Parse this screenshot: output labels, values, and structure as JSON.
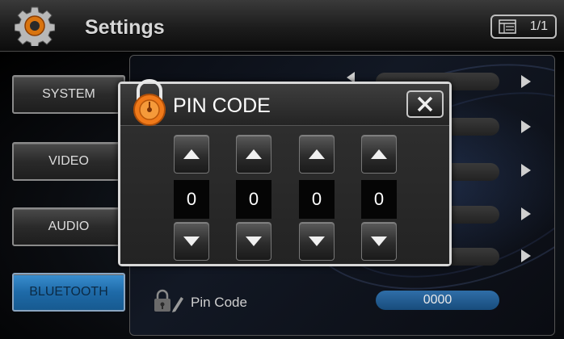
{
  "header": {
    "title": "Settings",
    "page_indicator": "1/1",
    "icons": [
      "gear-icon",
      "list-icon"
    ]
  },
  "sidebar": {
    "items": [
      {
        "label": "SYSTEM",
        "active": false
      },
      {
        "label": "VIDEO",
        "active": false
      },
      {
        "label": "AUDIO",
        "active": false
      },
      {
        "label": "BLUETOOTH",
        "active": true
      }
    ]
  },
  "settings_panel": {
    "pin_row": {
      "label": "Pin Code",
      "value": "0000",
      "icon": "lock-edit-icon"
    }
  },
  "pin_dialog": {
    "title": "PIN CODE",
    "close_icon": "close-icon",
    "digits": [
      "0",
      "0",
      "0",
      "0"
    ]
  },
  "colors": {
    "accent": "#1e6aa8",
    "lock_orange": "#f07a1a"
  }
}
